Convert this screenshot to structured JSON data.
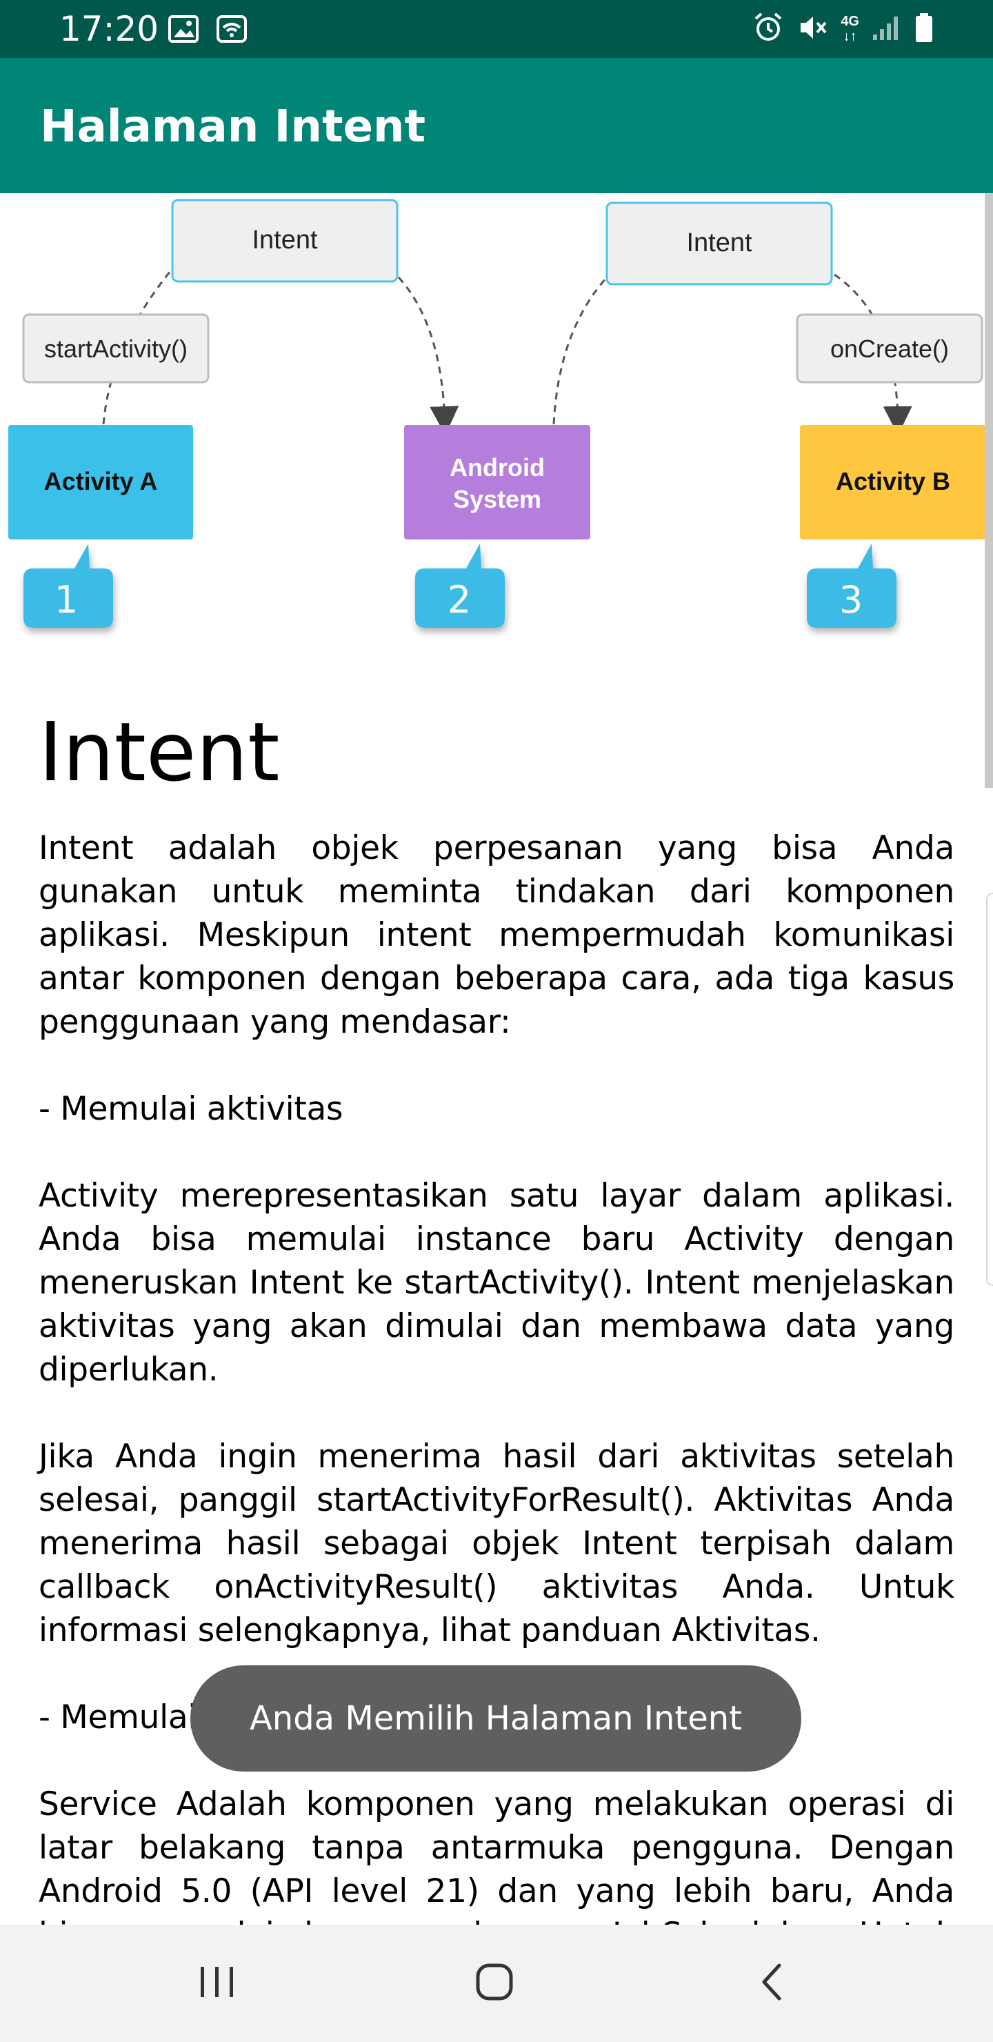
{
  "status_bar": {
    "time": "17:20",
    "left_icons": [
      "image-icon",
      "wifi-icon"
    ],
    "right_icons": [
      "alarm-icon",
      "mute-icon",
      "network-4g-icon",
      "signal-icon",
      "battery-icon"
    ],
    "network_label": "4G"
  },
  "app_bar": {
    "title": "Halaman Intent"
  },
  "diagram": {
    "intent_left": "Intent",
    "intent_right": "Intent",
    "start_activity": "startActivity()",
    "on_create": "onCreate()",
    "activity_a": "Activity A",
    "android_system_line1": "Android",
    "android_system_line2": "System",
    "activity_b": "Activity B",
    "step1": "1",
    "step2": "2",
    "step3": "3",
    "colors": {
      "activity_a": "#3BC0EA",
      "android_system": "#B57EDC",
      "activity_b": "#FFC640",
      "step_badge": "#3BBBE6",
      "intent_box_border": "#4DC3F0"
    }
  },
  "content": {
    "heading": "Intent",
    "paragraphs": [
      "Intent adalah objek perpesanan yang bisa Anda gunakan untuk meminta tindakan dari komponen aplikasi. Meskipun intent mempermudah komunikasi antar komponen dengan beberapa cara, ada tiga kasus penggunaan yang mendasar:",
      "- Memulai aktivitas",
      "Activity merepresentasikan satu layar dalam aplikasi. Anda bisa memulai instance baru Activity dengan meneruskan Intent ke startActivity(). Intent menjelaskan aktivitas yang akan dimulai dan membawa data yang diperlukan.",
      "Jika Anda ingin menerima hasil dari aktivitas setelah selesai, panggil startActivityForResult(). Aktivitas Anda menerima hasil sebagai objek Intent terpisah dalam callback onActivityResult() aktivitas Anda. Untuk informasi selengkapnya, lihat panduan Aktivitas.",
      "- Memulai layanan",
      "Service Adalah komponen yang melakukan operasi di latar belakang tanpa antarmuka pengguna. Dengan Android 5.0 (API level 21) dan yang lebih baru, Anda bisa memulai layanan dengan JobScheduler. Untuk informasi"
    ]
  },
  "toast": {
    "text": "Anda Memilih Halaman Intent"
  },
  "nav_bar": {
    "buttons": [
      "recents-icon",
      "home-icon",
      "back-icon"
    ]
  },
  "colors": {
    "status_bar": "#00574B",
    "app_bar": "#008577",
    "toast": "#5F5F5F"
  }
}
